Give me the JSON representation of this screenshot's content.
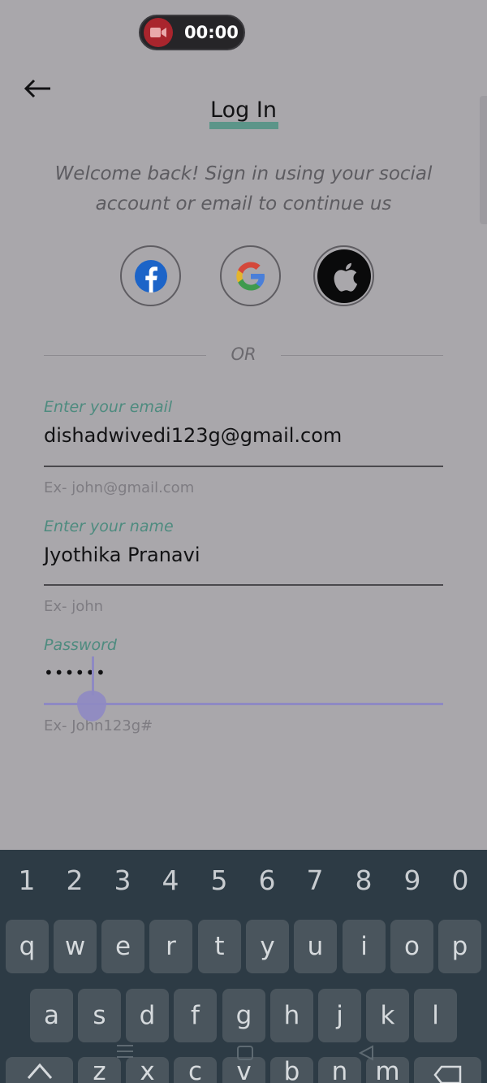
{
  "recorder": {
    "time": "00:00"
  },
  "header": {
    "title": "Log In"
  },
  "intro": {
    "subtitle_line1": "Welcome back! Sign in using your social",
    "subtitle_line2": "account or email to continue us"
  },
  "social": {
    "facebook": "facebook-icon",
    "google": "google-icon",
    "apple": "apple-icon"
  },
  "divider": {
    "text": "OR"
  },
  "form": {
    "email": {
      "label": "Enter your email",
      "value": "dishadwivedi123g@gmail.com",
      "hint": "Ex- john@gmail.com"
    },
    "name": {
      "label": "Enter your name",
      "value": "Jyothika Pranavi",
      "hint": "Ex- john"
    },
    "password": {
      "label": "Password",
      "value": "••••••",
      "hint": "Ex- John123g#"
    }
  },
  "keyboard": {
    "numbers": [
      "1",
      "2",
      "3",
      "4",
      "5",
      "6",
      "7",
      "8",
      "9",
      "0"
    ],
    "row1": [
      "q",
      "w",
      "e",
      "r",
      "t",
      "y",
      "u",
      "i",
      "o",
      "p"
    ],
    "row2": [
      "a",
      "s",
      "d",
      "f",
      "g",
      "h",
      "j",
      "k",
      "l"
    ],
    "row3": [
      "z",
      "x",
      "c",
      "v",
      "b",
      "n",
      "m"
    ]
  },
  "colors": {
    "accent": "#4e8b7f",
    "cursor": "#8e89c3",
    "keyboard_bg": "#2d3b45",
    "key_bg": "#4a555d"
  }
}
